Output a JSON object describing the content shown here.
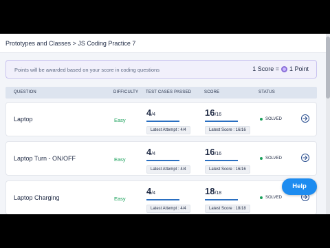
{
  "breadcrumb": {
    "parent": "Prototypes and Classes",
    "separator": ">",
    "current": "JS Coding Practice 7"
  },
  "banner": {
    "text": "Points will be awarded based on your score in coding questions",
    "score_left": "1 Score =",
    "score_right": "1 Point"
  },
  "table_headers": {
    "question": "QUESTION",
    "difficulty": "DIFFICULTY",
    "test_cases": "TEST CASES PASSED",
    "score": "SCORE",
    "status": "STATUS"
  },
  "rows": [
    {
      "title": "Laptop",
      "difficulty": "Easy",
      "tests_value": "4",
      "tests_total": "/4",
      "tests_tag": "Latest Attempt : 4/4",
      "score_value": "16",
      "score_total": "/16",
      "score_tag": "Latest Score : 16/16",
      "status": "SOLVED"
    },
    {
      "title": "Laptop Turn - ON/OFF",
      "difficulty": "Easy",
      "tests_value": "4",
      "tests_total": "/4",
      "tests_tag": "Latest Attempt : 4/4",
      "score_value": "16",
      "score_total": "/16",
      "score_tag": "Latest Score : 16/16",
      "status": "SOLVED"
    },
    {
      "title": "Laptop Charging",
      "difficulty": "Easy",
      "tests_value": "4",
      "tests_total": "/4",
      "tests_tag": "Latest Attempt : 4/4",
      "score_value": "18",
      "score_total": "/18",
      "score_tag": "Latest Score : 18/18",
      "status": "SOLVED"
    }
  ],
  "help": {
    "label": "Help"
  },
  "colors": {
    "accent": "#1d8cf0",
    "solved": "#19a05a",
    "easy": "#19a05a",
    "bar": "#2a6fc1"
  },
  "icons": {
    "row_action": "arrow-right-circle-icon",
    "score_coin": "coin-icon",
    "status_dot": "status-dot-icon"
  }
}
